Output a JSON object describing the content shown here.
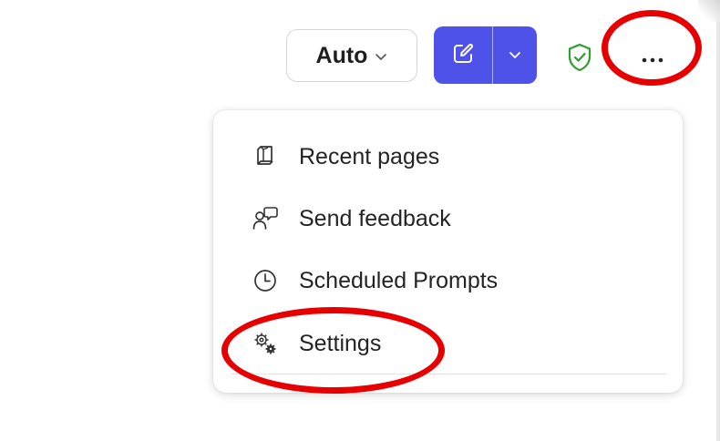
{
  "toolbar": {
    "mode_label": "Auto",
    "mode_icon": "chevron-down-icon",
    "compose_icon": "compose-icon",
    "compose_more_icon": "chevron-down-icon",
    "shield_icon": "shield-check-icon",
    "more_icon": "more-horizontal-icon",
    "accent_color": "#4f52e8",
    "shield_color": "#2e9e2e"
  },
  "menu": {
    "items": [
      {
        "label": "Recent pages",
        "icon": "book-icon"
      },
      {
        "label": "Send feedback",
        "icon": "feedback-icon"
      },
      {
        "label": "Scheduled Prompts",
        "icon": "clock-icon"
      },
      {
        "label": "Settings",
        "icon": "settings-icon"
      }
    ]
  },
  "annotations": {
    "highlight_color": "#e60000",
    "highlighted": [
      "more-options-button",
      "menu-item-settings"
    ]
  }
}
